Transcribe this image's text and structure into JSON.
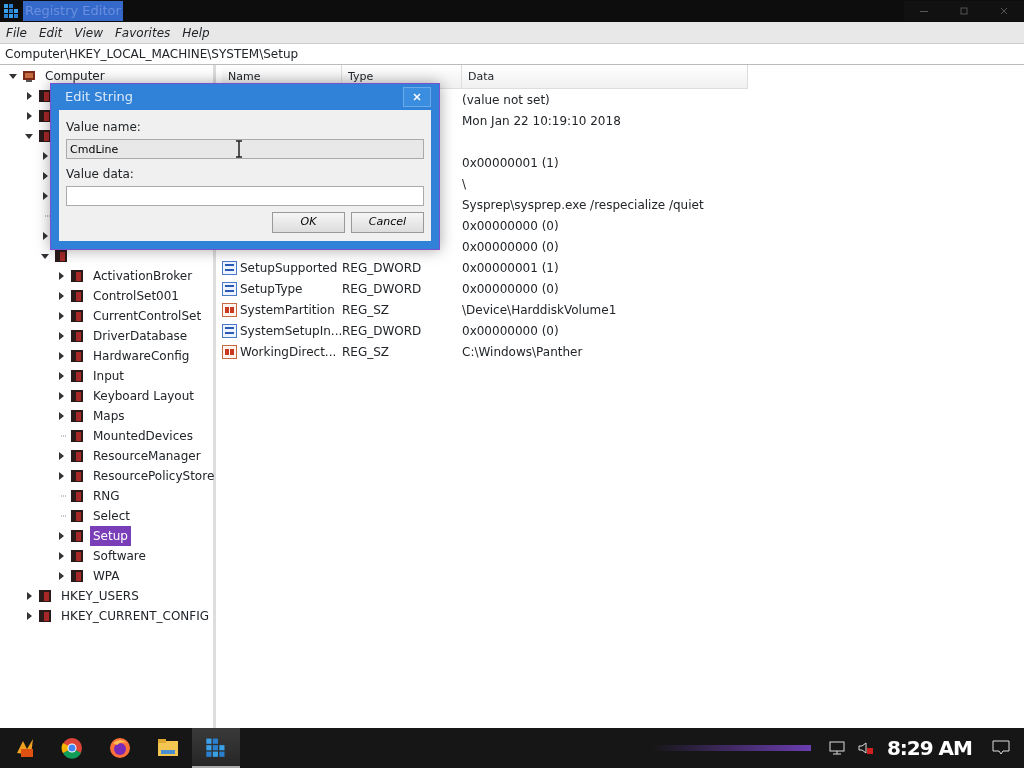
{
  "window": {
    "title": "Registry Editor"
  },
  "menu": [
    "File",
    "Edit",
    "View",
    "Favorites",
    "Help"
  ],
  "address": "Computer\\HKEY_LOCAL_MACHINE\\SYSTEM\\Setup",
  "tree": [
    {
      "label": "Computer",
      "expandable": true,
      "expanded": true,
      "selected": false,
      "children": [
        {
          "expandable": true,
          "expanded": false
        },
        {
          "expandable": true,
          "expanded": false
        },
        {
          "expandable": true,
          "expanded": true,
          "children": [
            {
              "expandable": true,
              "expanded": false
            },
            {
              "expandable": true,
              "expanded": false
            },
            {
              "expandable": true,
              "expanded": false
            },
            {
              "expandable": false
            },
            {
              "expandable": true,
              "expanded": false
            },
            {
              "expandable": true,
              "expanded": true,
              "children": [
                {
                  "label": "ActivationBroker",
                  "expandable": true,
                  "expanded": false,
                  "selected": false
                },
                {
                  "label": "ControlSet001",
                  "expandable": true,
                  "expanded": false,
                  "selected": false
                },
                {
                  "label": "CurrentControlSet",
                  "expandable": true,
                  "expanded": false,
                  "selected": false
                },
                {
                  "label": "DriverDatabase",
                  "expandable": true,
                  "expanded": false,
                  "selected": false
                },
                {
                  "label": "HardwareConfig",
                  "expandable": true,
                  "expanded": false,
                  "selected": false
                },
                {
                  "label": "Input",
                  "expandable": true,
                  "expanded": false,
                  "selected": false
                },
                {
                  "label": "Keyboard Layout",
                  "expandable": true,
                  "expanded": false,
                  "selected": false
                },
                {
                  "label": "Maps",
                  "expandable": true,
                  "expanded": false,
                  "selected": false
                },
                {
                  "label": "MountedDevices",
                  "expandable": false,
                  "selected": false
                },
                {
                  "label": "ResourceManager",
                  "expandable": true,
                  "expanded": false,
                  "selected": false
                },
                {
                  "label": "ResourcePolicyStore",
                  "expandable": true,
                  "expanded": false,
                  "selected": false
                },
                {
                  "label": "RNG",
                  "expandable": false,
                  "selected": false
                },
                {
                  "label": "Select",
                  "expandable": false,
                  "selected": false
                },
                {
                  "label": "Setup",
                  "expandable": true,
                  "expanded": false,
                  "selected": true
                },
                {
                  "label": "Software",
                  "expandable": true,
                  "expanded": false,
                  "selected": false
                },
                {
                  "label": "WPA",
                  "expandable": true,
                  "expanded": false,
                  "selected": false
                }
              ]
            }
          ]
        },
        {
          "label": "HKEY_USERS",
          "expandable": true,
          "expanded": false,
          "selected": false
        },
        {
          "label": "HKEY_CURRENT_CONFIG",
          "expandable": true,
          "expanded": false,
          "selected": false
        }
      ]
    }
  ],
  "columns": [
    "Name",
    "Type",
    "Data"
  ],
  "values": [
    {
      "data": "(value not set)"
    },
    {
      "data": "Mon Jan 22 10:19:10 2018"
    },
    {
      "data": "0x00000001 (1)",
      "blank_above": true
    },
    {
      "data": "\\"
    },
    {
      "data": "Sysprep\\sysprep.exe /respecialize /quiet"
    },
    {
      "data": "0x00000000 (0)"
    },
    {
      "data": "0x00000000 (0)"
    },
    {
      "kind": "binary",
      "name": "SetupSupported",
      "type": "REG_DWORD",
      "data": "0x00000001 (1)"
    },
    {
      "kind": "binary",
      "name": "SetupType",
      "type": "REG_DWORD",
      "data": "0x00000000 (0)"
    },
    {
      "kind": "string",
      "name": "SystemPartition",
      "type": "REG_SZ",
      "data": "\\Device\\HarddiskVolume1"
    },
    {
      "kind": "binary",
      "name": "SystemSetupIn...",
      "type": "REG_DWORD",
      "data": "0x00000000 (0)"
    },
    {
      "kind": "string",
      "name": "WorkingDirect...",
      "type": "REG_SZ",
      "data": "C:\\Windows\\Panther"
    }
  ],
  "dialog": {
    "title": "Edit String",
    "value_name_label": "Value name:",
    "value_name": "CmdLine",
    "value_data_label": "Value data:",
    "buttons": [
      "OK",
      "Cancel"
    ]
  },
  "taskbar": {
    "apps": [
      {
        "kind": "start",
        "active": false
      },
      {
        "kind": "chrome",
        "active": false
      },
      {
        "kind": "firefox",
        "active": false
      },
      {
        "kind": "folder",
        "active": false
      },
      {
        "kind": "registry",
        "active": true
      }
    ],
    "time": "8:29 AM"
  }
}
